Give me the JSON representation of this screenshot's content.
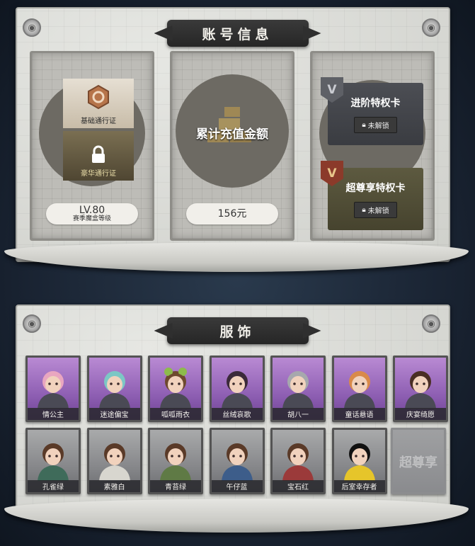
{
  "account_section": {
    "title": "账号信息",
    "pass_card": {
      "basic_pass_label": "基础通行证",
      "luxury_pass_label": "豪华通行证",
      "level_value": "LV.80",
      "level_caption": "赛季魔盒等级"
    },
    "recharge_card": {
      "title": "累计充值金额",
      "amount": "156元"
    },
    "privilege_card": {
      "advanced_title": "进阶特权卡",
      "advanced_status": "未解锁",
      "supreme_title": "超尊享特权卡",
      "supreme_status": "未解锁",
      "badge_letter": "V"
    }
  },
  "costume_section": {
    "title": "服饰",
    "row1": [
      {
        "name": "情公主",
        "rarity": "purple",
        "hair": "#e9a6c0",
        "tag": "#e85a8b"
      },
      {
        "name": "迷途偏宝",
        "rarity": "purple",
        "hair": "#7cc7c5"
      },
      {
        "name": "呱呱雨衣",
        "rarity": "purple",
        "hair": "#6e4a2f",
        "hat": "#8dbb4c"
      },
      {
        "name": "丝绒哀歌",
        "rarity": "purple",
        "hair": "#3b2a3a"
      },
      {
        "name": "胡八一",
        "rarity": "purple",
        "hair": "#a6a8ad"
      },
      {
        "name": "童话悬语",
        "rarity": "purple",
        "hair": "#d98a4a"
      },
      {
        "name": "庆宴绮愿",
        "rarity": "purple",
        "hair": "#4a2e24"
      }
    ],
    "row2": [
      {
        "name": "孔雀绿",
        "rarity": "grey",
        "hair": "#5a3a28",
        "cloth": "#3f6b5a"
      },
      {
        "name": "素雅白",
        "rarity": "grey",
        "hair": "#5a3a28",
        "cloth": "#d8d6cf"
      },
      {
        "name": "青苔绿",
        "rarity": "grey",
        "hair": "#5a3a28",
        "cloth": "#5f7a45"
      },
      {
        "name": "午仔蓝",
        "rarity": "grey",
        "hair": "#5a3a28",
        "cloth": "#3d5d8a"
      },
      {
        "name": "宝石红",
        "rarity": "grey",
        "hair": "#5a3a28",
        "cloth": "#9b3a3a"
      },
      {
        "name": "后室幸存者",
        "rarity": "grey",
        "hair": "#111",
        "cloth": "#e6c52a"
      }
    ],
    "locked_slot_text": "超尊享"
  }
}
